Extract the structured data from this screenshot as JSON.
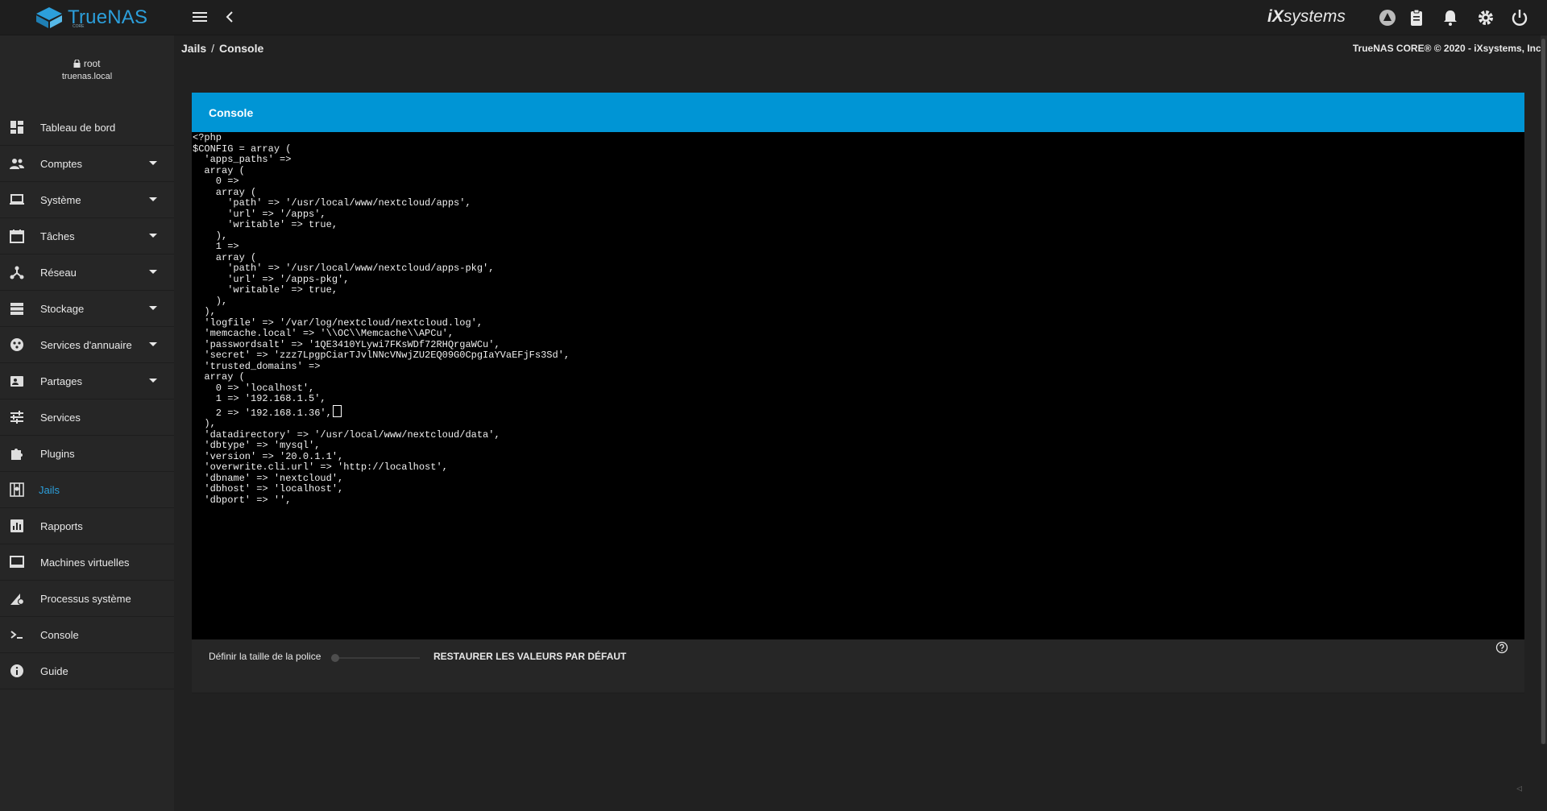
{
  "app": {
    "logo_text": "TrueNAS",
    "logo_sub": "CORE",
    "vendor": "iXsystems",
    "vendor_prefix": "iX",
    "vendor_suffix": "systems",
    "copyright": "TrueNAS CORE® © 2020 - iXsystems, Inc.",
    "accent": "#0095d5"
  },
  "user": {
    "name": "root",
    "host": "truenas.local"
  },
  "breadcrumb": [
    "Jails",
    "Console"
  ],
  "sidebar": {
    "items": [
      {
        "label": "Tableau de bord",
        "icon": "dashboard-icon",
        "expandable": false
      },
      {
        "label": "Comptes",
        "icon": "people-icon",
        "expandable": true
      },
      {
        "label": "Système",
        "icon": "laptop-icon",
        "expandable": true
      },
      {
        "label": "Tâches",
        "icon": "calendar-icon",
        "expandable": true
      },
      {
        "label": "Réseau",
        "icon": "network-icon",
        "expandable": true
      },
      {
        "label": "Stockage",
        "icon": "storage-icon",
        "expandable": true
      },
      {
        "label": "Services d'annuaire",
        "icon": "directory-icon",
        "expandable": true
      },
      {
        "label": "Partages",
        "icon": "shares-icon",
        "expandable": true
      },
      {
        "label": "Services",
        "icon": "tune-icon",
        "expandable": false
      },
      {
        "label": "Plugins",
        "icon": "puzzle-icon",
        "expandable": false
      },
      {
        "label": "Jails",
        "icon": "jail-icon",
        "expandable": false,
        "active": true
      },
      {
        "label": "Rapports",
        "icon": "chart-icon",
        "expandable": false
      },
      {
        "label": "Machines virtuelles",
        "icon": "computer-icon",
        "expandable": false
      },
      {
        "label": "Processus système",
        "icon": "process-icon",
        "expandable": false
      },
      {
        "label": "Console",
        "icon": "terminal-icon",
        "expandable": false
      },
      {
        "label": "Guide",
        "icon": "info-icon",
        "expandable": false
      }
    ]
  },
  "console": {
    "title": "Console",
    "lines": [
      "<?php",
      "$CONFIG = array (",
      "  'apps_paths' =>",
      "  array (",
      "    0 =>",
      "    array (",
      "      'path' => '/usr/local/www/nextcloud/apps',",
      "      'url' => '/apps',",
      "      'writable' => true,",
      "    ),",
      "    1 =>",
      "    array (",
      "      'path' => '/usr/local/www/nextcloud/apps-pkg',",
      "      'url' => '/apps-pkg',",
      "      'writable' => true,",
      "    ),",
      "  ),",
      "  'logfile' => '/var/log/nextcloud/nextcloud.log',",
      "  'memcache.local' => '\\\\OC\\\\Memcache\\\\APCu',",
      "  'passwordsalt' => '1QE3410YLywi7FKsWDf72RHQrgaWCu',",
      "  'secret' => 'zzz7LpgpCiarTJvlNNcVNwjZU2EQ09G0CpgIaYVaEFjFs3Sd',",
      "  'trusted_domains' =>",
      "  array (",
      "    0 => 'localhost',",
      "    1 => '192.168.1.5',",
      "    2 => '192.168.1.36',",
      "  ),",
      "  'datadirectory' => '/usr/local/www/nextcloud/data',",
      "  'dbtype' => 'mysql',",
      "  'version' => '20.0.1.1',",
      "  'overwrite.cli.url' => 'http://localhost',",
      "  'dbname' => 'nextcloud',",
      "  'dbhost' => 'localhost',",
      "  'dbport' => '',"
    ],
    "cursor_line": 25
  },
  "footer": {
    "font_size_label": "Définir la taille de la police",
    "font_size_value": 0,
    "restore_label": "RESTAURER LES VALEURS PAR DÉFAUT"
  }
}
